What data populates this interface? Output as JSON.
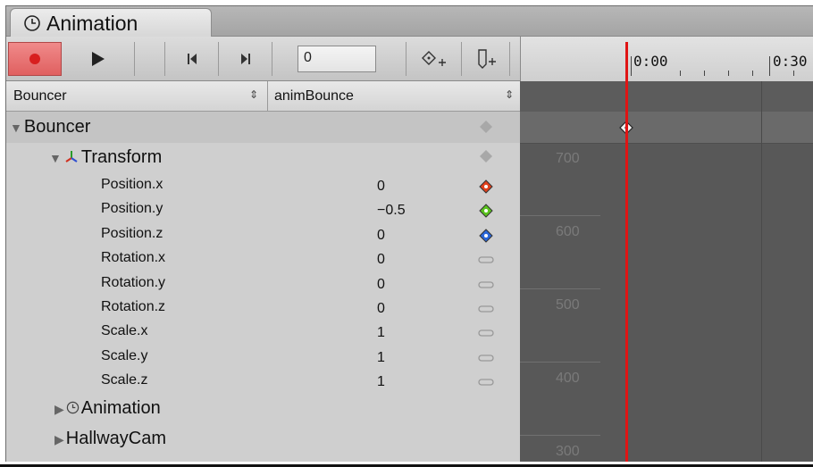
{
  "tab": {
    "title": "Animation"
  },
  "toolbar": {
    "frame_value": "0"
  },
  "ruler": {
    "labels": [
      "0:00",
      "0:30"
    ]
  },
  "header": {
    "object": "Bouncer",
    "clip": "animBounce"
  },
  "tree": {
    "root": "Bouncer",
    "transform": "Transform",
    "animation": "Animation",
    "camera": "HallwayCam"
  },
  "properties": [
    {
      "name": "Position.x",
      "value": "0",
      "key_color": "#e0401c"
    },
    {
      "name": "Position.y",
      "value": "−0.5",
      "key_color": "#5ac21e"
    },
    {
      "name": "Position.z",
      "value": "0",
      "key_color": "#2a66d8"
    },
    {
      "name": "Rotation.x",
      "value": "0"
    },
    {
      "name": "Rotation.y",
      "value": "0"
    },
    {
      "name": "Rotation.z",
      "value": "0"
    },
    {
      "name": "Scale.x",
      "value": "1"
    },
    {
      "name": "Scale.y",
      "value": "1"
    },
    {
      "name": "Scale.z",
      "value": "1"
    }
  ],
  "curve_labels": [
    "700",
    "600",
    "500",
    "400",
    "300"
  ],
  "colors": {
    "playhead": "#e01414",
    "record": "#d81f1f"
  }
}
